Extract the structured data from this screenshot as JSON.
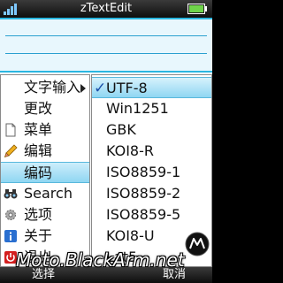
{
  "status_bar": {
    "title": "zTextEdit",
    "signal_icon": "signal-bars-icon",
    "battery_icon": "battery-icon"
  },
  "main_menu": {
    "items": [
      {
        "label": "文字输入",
        "icon": "",
        "selected": false,
        "has_submenu": true
      },
      {
        "label": "更改",
        "icon": "",
        "selected": false,
        "has_submenu": false
      },
      {
        "label": "菜单",
        "icon": "document-icon",
        "selected": false,
        "has_submenu": false
      },
      {
        "label": "编辑",
        "icon": "pencil-icon",
        "selected": false,
        "has_submenu": false
      },
      {
        "label": "编码",
        "icon": "",
        "selected": true,
        "has_submenu": false
      },
      {
        "label": "Search",
        "icon": "binoculars-icon",
        "selected": false,
        "has_submenu": false
      },
      {
        "label": "选项",
        "icon": "gear-icon",
        "selected": false,
        "has_submenu": false
      },
      {
        "label": "关于",
        "icon": "info-icon",
        "selected": false,
        "has_submenu": false
      },
      {
        "label": "退出",
        "icon": "power-icon",
        "selected": false,
        "has_submenu": false
      }
    ]
  },
  "encoding_menu": {
    "checkmark": "✓",
    "items": [
      {
        "label": "UTF-8",
        "checked": true,
        "selected": true
      },
      {
        "label": "Win1251",
        "checked": false,
        "selected": false
      },
      {
        "label": "GBK",
        "checked": false,
        "selected": false
      },
      {
        "label": "KOI8-R",
        "checked": false,
        "selected": false
      },
      {
        "label": "ISO8859-1",
        "checked": false,
        "selected": false
      },
      {
        "label": "ISO8859-2",
        "checked": false,
        "selected": false
      },
      {
        "label": "ISO8859-5",
        "checked": false,
        "selected": false
      },
      {
        "label": "KOI8-U",
        "checked": false,
        "selected": false
      },
      {
        "label": "Lat5",
        "checked": false,
        "selected": false
      }
    ]
  },
  "soft_keys": {
    "left": "选择",
    "right": "取消"
  },
  "watermark": "Moto.BlackArm.net",
  "colors": {
    "accent": "#2ab6e0",
    "highlight": "#8fd6f2",
    "bar": "#1a1a1a"
  }
}
